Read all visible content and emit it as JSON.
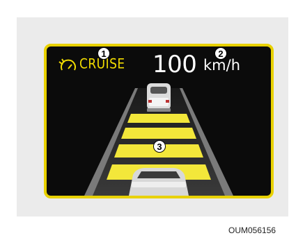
{
  "cruise": {
    "icon": "cruise-gauge-icon",
    "label": "CRUISE",
    "callout": "1"
  },
  "speed": {
    "value": "100",
    "unit": "km/h",
    "callout": "2"
  },
  "distance": {
    "callout": "3",
    "bars_shown": 4
  },
  "image_code": "OUM056156",
  "colors": {
    "border": "#e8d100",
    "cruise_text": "#f2dc00",
    "distance_bar": "#f3e73a",
    "background": "#0b0b0b"
  }
}
